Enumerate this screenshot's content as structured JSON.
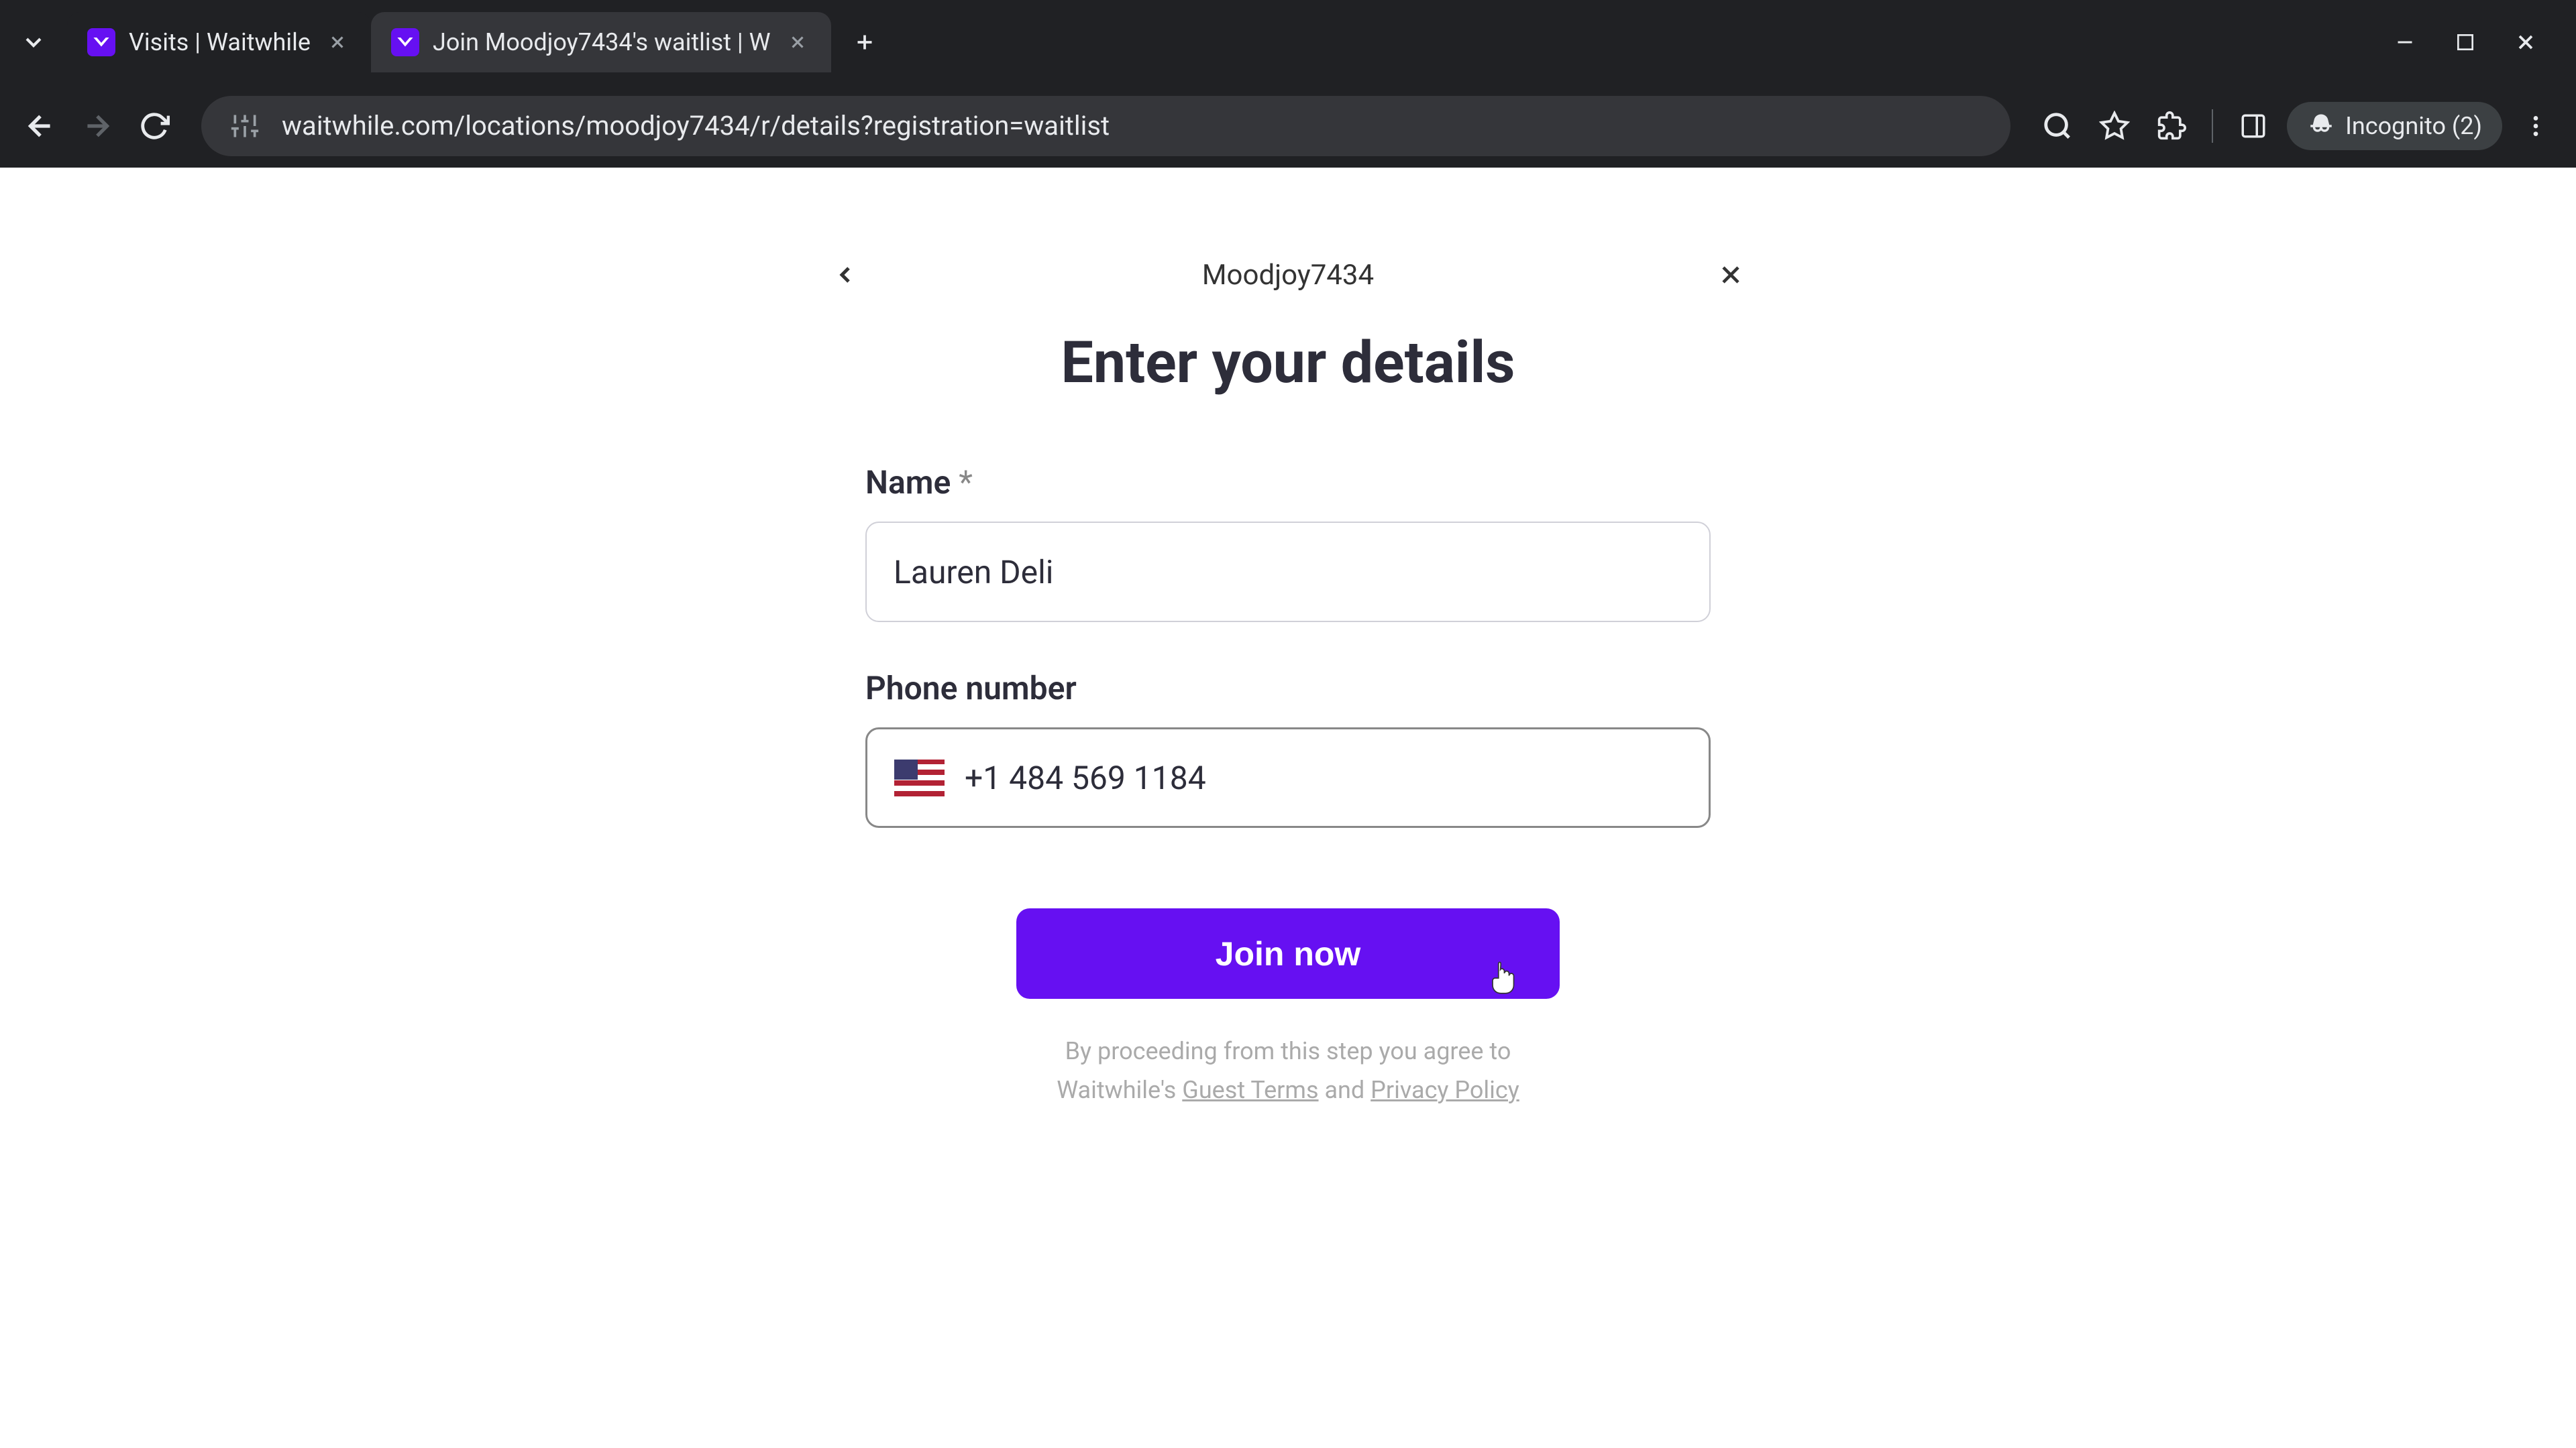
{
  "browser": {
    "tabs": [
      {
        "title": "Visits | Waitwhile",
        "active": false
      },
      {
        "title": "Join Moodjoy7434's waitlist | W",
        "active": true
      }
    ],
    "url": "waitwhile.com/locations/moodjoy7434/r/details?registration=waitlist",
    "incognito_label": "Incognito (2)"
  },
  "form": {
    "location_name": "Moodjoy7434",
    "title": "Enter your details",
    "name_label": "Name",
    "name_required": "*",
    "name_value": "Lauren Deli",
    "phone_label": "Phone number",
    "phone_value": "+1 484 569 1184",
    "submit_label": "Join now",
    "terms_intro": "By proceeding from this step you agree to",
    "terms_brand": "Waitwhile's",
    "terms_link1": "Guest Terms",
    "terms_and": "and",
    "terms_link2": "Privacy Policy"
  }
}
